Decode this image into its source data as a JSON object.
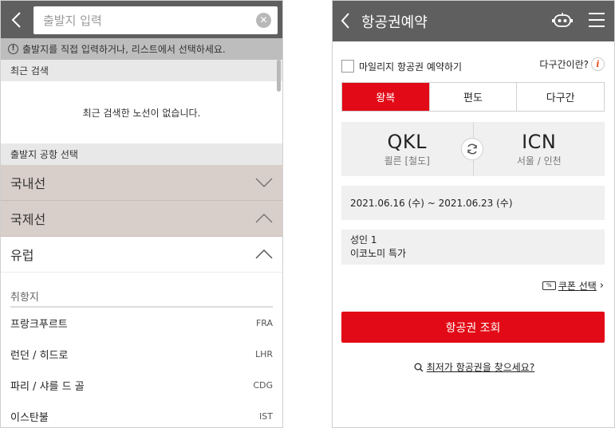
{
  "left": {
    "search": {
      "placeholder": "출발지 입력"
    },
    "notice": "출발지를 직접 입력하거나, 리스트에서 선택하세요.",
    "recent": {
      "heading": "최근 검색",
      "empty_text": "최근 검색한 노선이 없습니다."
    },
    "airport_heading": "출발지 공항 선택",
    "accordions": [
      {
        "label": "국내선",
        "expanded": false
      },
      {
        "label": "국제선",
        "expanded": true
      },
      {
        "label": "유럽",
        "expanded": true
      }
    ],
    "destinations_label": "취항지",
    "cities": [
      {
        "name": "프랑크푸르트",
        "code": "FRA"
      },
      {
        "name": "런던 / 히드로",
        "code": "LHR"
      },
      {
        "name": "파리 / 샤를 드 골",
        "code": "CDG"
      },
      {
        "name": "이스탄불",
        "code": "IST"
      }
    ]
  },
  "right": {
    "header": {
      "title": "항공권예약"
    },
    "mileage_label": "마일리지 항공권 예약하기",
    "multi_help": "다구간이란?",
    "info_icon_glyph": "i",
    "trip_types": [
      "왕복",
      "편도",
      "다구간"
    ],
    "active_trip_type": "왕복",
    "origin": {
      "code": "QKL",
      "city": "쾰른 [철도]"
    },
    "destination": {
      "code": "ICN",
      "city": "서울 / 인천"
    },
    "dates": "2021.06.16 (수) ~ 2021.06.23 (수)",
    "passengers": "성인 1",
    "cabin": "이코노미 특가",
    "coupon_label": "쿠폰 선택",
    "search_button": "항공권 조회",
    "lowest_fare_link": "최저가 항공권을 찾으세요?"
  },
  "colors": {
    "header_bg": "#5f5f5f",
    "accent_red": "#e20a16",
    "accordion_tint": "#d9cfca",
    "info_icon": "#e8501e"
  }
}
